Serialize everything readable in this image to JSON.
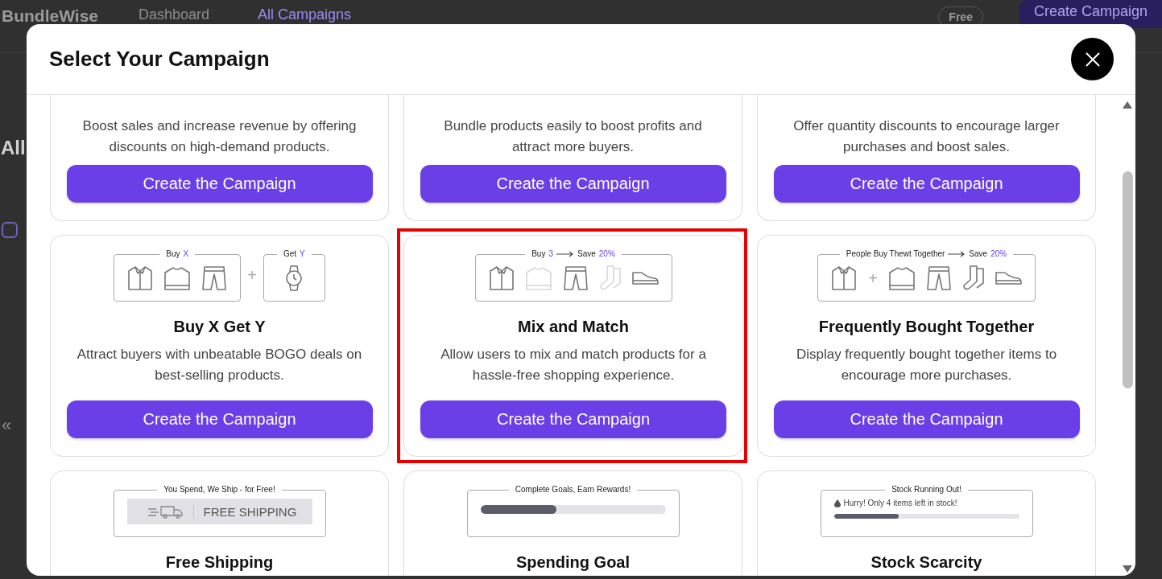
{
  "background_page": {
    "logo": "BundleWise",
    "nav": [
      {
        "label": "Dashboard",
        "selected": false
      },
      {
        "label": "All Campaigns",
        "selected": true
      }
    ],
    "plan_badge": "Free",
    "create_button": "Create Campaign",
    "heading": "All",
    "checkbox": {
      "checked": false
    },
    "pager": "«"
  },
  "modal": {
    "title": "Select Your Campaign",
    "cards": [
      {
        "cut_top": true,
        "highlighted": false,
        "description": "Boost sales and increase revenue by offering discounts on high-demand products.",
        "button": "Create the Campaign"
      },
      {
        "cut_top": true,
        "highlighted": false,
        "description": "Bundle products easily to boost profits and attract more buyers.",
        "button": "Create the Campaign"
      },
      {
        "cut_top": true,
        "highlighted": false,
        "description": "Offer quantity discounts to encourage larger purchases and boost sales.",
        "button": "Create the Campaign"
      },
      {
        "cut_top": false,
        "highlighted": false,
        "title": "Buy X Get Y",
        "description": "Attract buyers with unbeatable BOGO deals on best-selling products.",
        "button": "Create the Campaign",
        "illustration": {
          "kind": "products",
          "boxes": [
            {
              "caption": [
                {
                  "kind": "text",
                  "text": "Buy"
                },
                {
                  "kind": "accent",
                  "text": "X"
                }
              ],
              "items": [
                {
                  "kind": "shirt",
                  "faded": false
                },
                {
                  "kind": "sweater",
                  "faded": false
                },
                {
                  "kind": "pants",
                  "faded": false
                }
              ]
            },
            {
              "prefix": "+",
              "caption": [
                {
                  "kind": "text",
                  "text": "Get"
                },
                {
                  "kind": "accent",
                  "text": "Y"
                }
              ],
              "items": [
                {
                  "kind": "watch",
                  "faded": false
                }
              ]
            }
          ]
        }
      },
      {
        "cut_top": false,
        "highlighted": true,
        "title": "Mix and Match",
        "description": "Allow users to mix and match products for a hassle-free shopping experience.",
        "button": "Create the Campaign",
        "illustration": {
          "kind": "products",
          "boxes": [
            {
              "caption": [
                {
                  "kind": "text",
                  "text": "Buy"
                },
                {
                  "kind": "accent",
                  "text": "3"
                },
                {
                  "kind": "arrow"
                },
                {
                  "kind": "text",
                  "text": "Save"
                },
                {
                  "kind": "accent",
                  "text": "20%"
                }
              ],
              "items": [
                {
                  "kind": "shirt",
                  "faded": false
                },
                {
                  "kind": "sweater",
                  "faded": true
                },
                {
                  "kind": "pants",
                  "faded": false
                },
                {
                  "kind": "socks",
                  "faded": true
                },
                {
                  "kind": "shoe",
                  "faded": false
                }
              ]
            }
          ]
        }
      },
      {
        "cut_top": false,
        "highlighted": false,
        "title": "Frequently Bought Together",
        "description": "Display frequently bought together items to encourage more purchases.",
        "button": "Create the Campaign",
        "illustration": {
          "kind": "products",
          "boxes": [
            {
              "caption": [
                {
                  "kind": "text",
                  "text": "People Buy Thewt Together"
                },
                {
                  "kind": "arrow"
                },
                {
                  "kind": "text",
                  "text": "Save"
                },
                {
                  "kind": "accent",
                  "text": "20%"
                }
              ],
              "items": [
                {
                  "kind": "shirt",
                  "faded": false
                },
                {
                  "kind": "plus",
                  "text": "+"
                },
                {
                  "kind": "sweater",
                  "faded": false
                },
                {
                  "kind": "pants",
                  "faded": false
                },
                {
                  "kind": "socks",
                  "faded": false
                },
                {
                  "kind": "shoe",
                  "faded": false
                }
              ]
            }
          ]
        }
      },
      {
        "cut_top": false,
        "highlighted": false,
        "title": "Free Shipping",
        "illustration": {
          "kind": "shipping",
          "caption": "You Spend, We Ship - for Free!",
          "banner": "FREE SHIPPING"
        }
      },
      {
        "cut_top": false,
        "highlighted": false,
        "title": "Spending Goal",
        "illustration": {
          "kind": "progress",
          "caption": "Complete Goals, Earn Rewards!",
          "level": 0.41
        }
      },
      {
        "cut_top": false,
        "highlighted": false,
        "title": "Stock Scarcity",
        "illustration": {
          "kind": "stock",
          "caption": "Stock Running Out!",
          "note": "Hurry! Only 4 items left in stock!",
          "level": 0.35
        }
      }
    ]
  }
}
